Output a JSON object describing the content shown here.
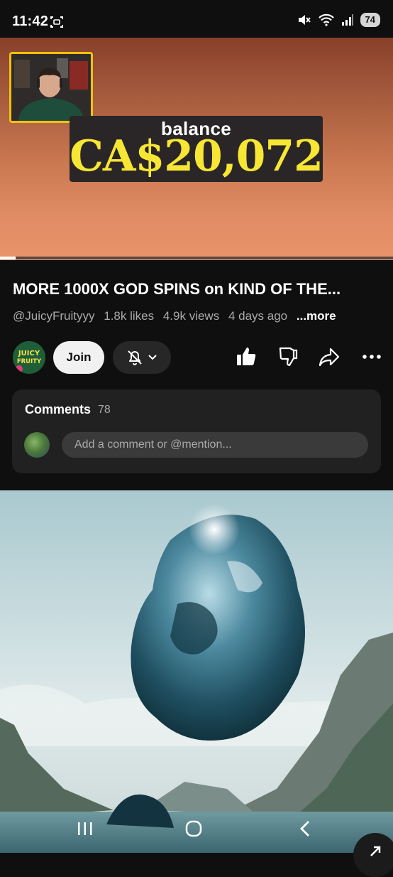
{
  "status_bar": {
    "time": "11:42",
    "battery": "74"
  },
  "player": {
    "overlay_label": "balance",
    "overlay_value": "CA$20,072",
    "progress_fraction": 0.04
  },
  "video": {
    "title": "MORE 1000X GOD SPINS on KIND OF THE...",
    "channel": "@JuicyFruityyy",
    "likes": "1.8k likes",
    "views": "4.9k views",
    "age": "4 days ago",
    "more_label": "...more"
  },
  "channel_avatar": {
    "text_top": "JUICY",
    "text_bottom": "FRUITY"
  },
  "actions": {
    "join_label": "Join",
    "bell_icon": "bell-off-icon",
    "like_icon": "thumbs-up-icon",
    "dislike_icon": "thumbs-down-icon",
    "share_icon": "share-icon",
    "more_icon": "more-horizontal-icon"
  },
  "comments": {
    "title": "Comments",
    "count": "78",
    "placeholder": "Add a comment or @mention..."
  },
  "colors": {
    "background": "#0f0f0f",
    "card": "#212121",
    "balance_yellow": "#f7e634",
    "webcam_border": "#f2c20b"
  }
}
